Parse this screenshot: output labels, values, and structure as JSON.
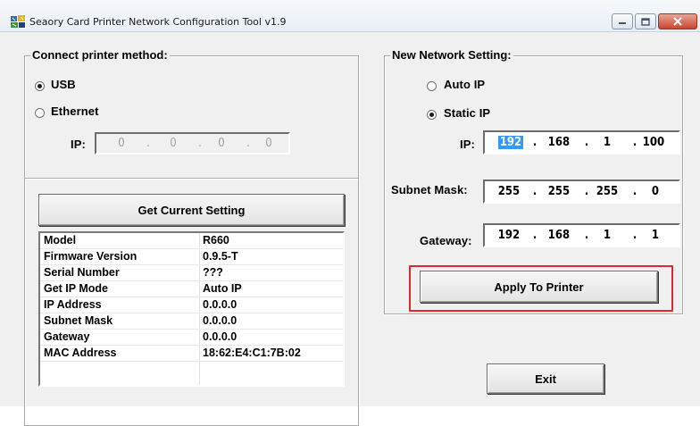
{
  "window": {
    "title": "Seaory Card Printer Network Configuration Tool   v1.9"
  },
  "connect": {
    "group_title": "Connect printer method:",
    "usb_label": "USB",
    "usb_checked": true,
    "ethernet_label": "Ethernet",
    "ethernet_checked": false,
    "ip_label": "IP:",
    "ip_octets": [
      "0",
      "0",
      "0",
      "0"
    ],
    "ip_dots": [
      ".",
      ".",
      "."
    ]
  },
  "current": {
    "button_label": "Get Current Setting",
    "rows": [
      {
        "key": "Model",
        "value": "R660"
      },
      {
        "key": "Firmware Version",
        "value": "0.9.5-T"
      },
      {
        "key": "Serial Number",
        "value": "???"
      },
      {
        "key": "Get IP Mode",
        "value": "Auto IP"
      },
      {
        "key": "IP Address",
        "value": "0.0.0.0"
      },
      {
        "key": "Subnet Mask",
        "value": "0.0.0.0"
      },
      {
        "key": "Gateway",
        "value": "0.0.0.0"
      },
      {
        "key": "MAC Address",
        "value": "18:62:E4:C1:7B:02"
      }
    ]
  },
  "new_setting": {
    "group_title": "New Network Setting:",
    "auto_ip_label": "Auto IP",
    "auto_ip_checked": false,
    "static_ip_label": "Static IP",
    "static_ip_checked": true,
    "ip_label": "IP:",
    "ip_octets": [
      "192",
      "168",
      "1",
      "100"
    ],
    "subnet_label": "Subnet Mask:",
    "subnet_octets": [
      "255",
      "255",
      "255",
      "0"
    ],
    "gateway_label": "Gateway:",
    "gateway_octets": [
      "192",
      "168",
      "1",
      "1"
    ],
    "dots": [
      ".",
      ".",
      "."
    ],
    "apply_label": "Apply To Printer"
  },
  "exit_label": "Exit",
  "colors": {
    "highlight": "#e0282d",
    "selection": "#3399ff",
    "close_button": "#c8452e"
  }
}
